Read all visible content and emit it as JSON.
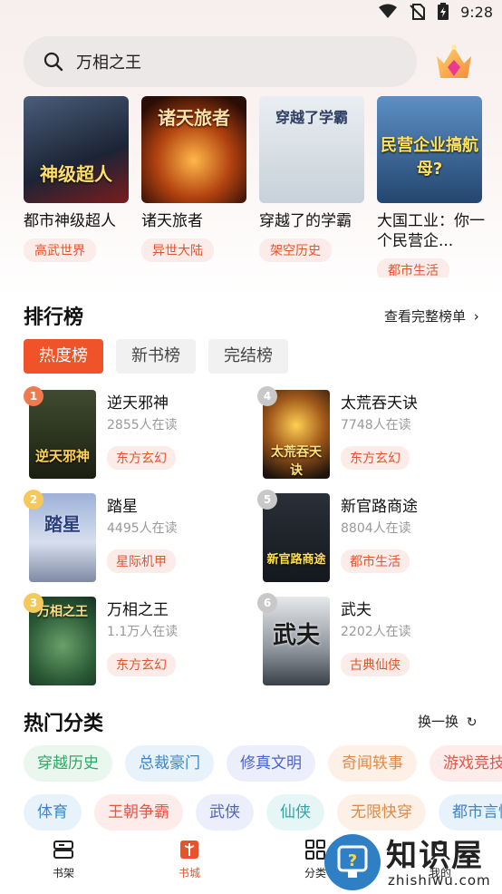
{
  "status": {
    "time": "9:28"
  },
  "search": {
    "query": "万相之王"
  },
  "featured": [
    {
      "name": "都市神级超人",
      "tag": "高武世界",
      "cover_text": "神级超人"
    },
    {
      "name": "诸天旅者",
      "tag": "异世大陆",
      "cover_text": "诸天旅者"
    },
    {
      "name": "穿越了的学霸",
      "tag": "架空历史",
      "cover_text": "穿越了学霸"
    },
    {
      "name": "大国工业：你一个民营企...",
      "tag": "都市生活",
      "cover_text": "民营企业搞航母?"
    }
  ],
  "ranking": {
    "title": "排行榜",
    "more": "查看完整榜单",
    "tabs": [
      "热度榜",
      "新书榜",
      "完结榜"
    ],
    "items": [
      {
        "rank": "1",
        "name": "逆天邪神",
        "readers": "2855人在读",
        "tag": "东方玄幻",
        "cover_text": "逆天邪神"
      },
      {
        "rank": "4",
        "name": "太荒吞天诀",
        "readers": "7748人在读",
        "tag": "东方玄幻",
        "cover_text": "太荒吞天诀"
      },
      {
        "rank": "2",
        "name": "踏星",
        "readers": "4495人在读",
        "tag": "星际机甲",
        "cover_text": "踏星"
      },
      {
        "rank": "5",
        "name": "新官路商途",
        "readers": "8804人在读",
        "tag": "都市生活",
        "cover_text": "新官路商途"
      },
      {
        "rank": "3",
        "name": "万相之王",
        "readers": "1.1万人在读",
        "tag": "东方玄幻",
        "cover_text": "万相之王"
      },
      {
        "rank": "6",
        "name": "武夫",
        "readers": "2202人在读",
        "tag": "古典仙侠",
        "cover_text": "武夫"
      }
    ]
  },
  "categories": {
    "title": "热门分类",
    "refresh": "换一换",
    "row1": [
      "穿越历史",
      "总裁豪门",
      "修真文明",
      "奇闻轶事",
      "游戏竞技"
    ],
    "row2": [
      "体育",
      "王朝争霸",
      "武侠",
      "仙侠",
      "无限快穿",
      "都市言情"
    ]
  },
  "nav": {
    "shelf": "书架",
    "store": "书城",
    "category": "分类",
    "mine": "我的"
  },
  "watermark": {
    "cn": "知识屋",
    "url": "zhishiwu.com"
  },
  "colors": {
    "accent": "#f0532a",
    "tag_bg": "#fbecea",
    "tag_text": "#e4542c"
  }
}
